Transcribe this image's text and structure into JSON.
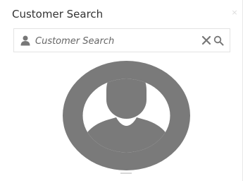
{
  "window": {
    "title": "Customer Search"
  },
  "search": {
    "placeholder": "Customer Search",
    "value": ""
  },
  "icons": {
    "field_icon": "user-icon",
    "clear": "clear-icon",
    "search": "search-icon",
    "avatar": "avatar-placeholder-icon",
    "close": "close-icon"
  },
  "colors": {
    "avatar": "#7a7a7a",
    "icon": "#777777",
    "border": "#e3e3e3"
  }
}
